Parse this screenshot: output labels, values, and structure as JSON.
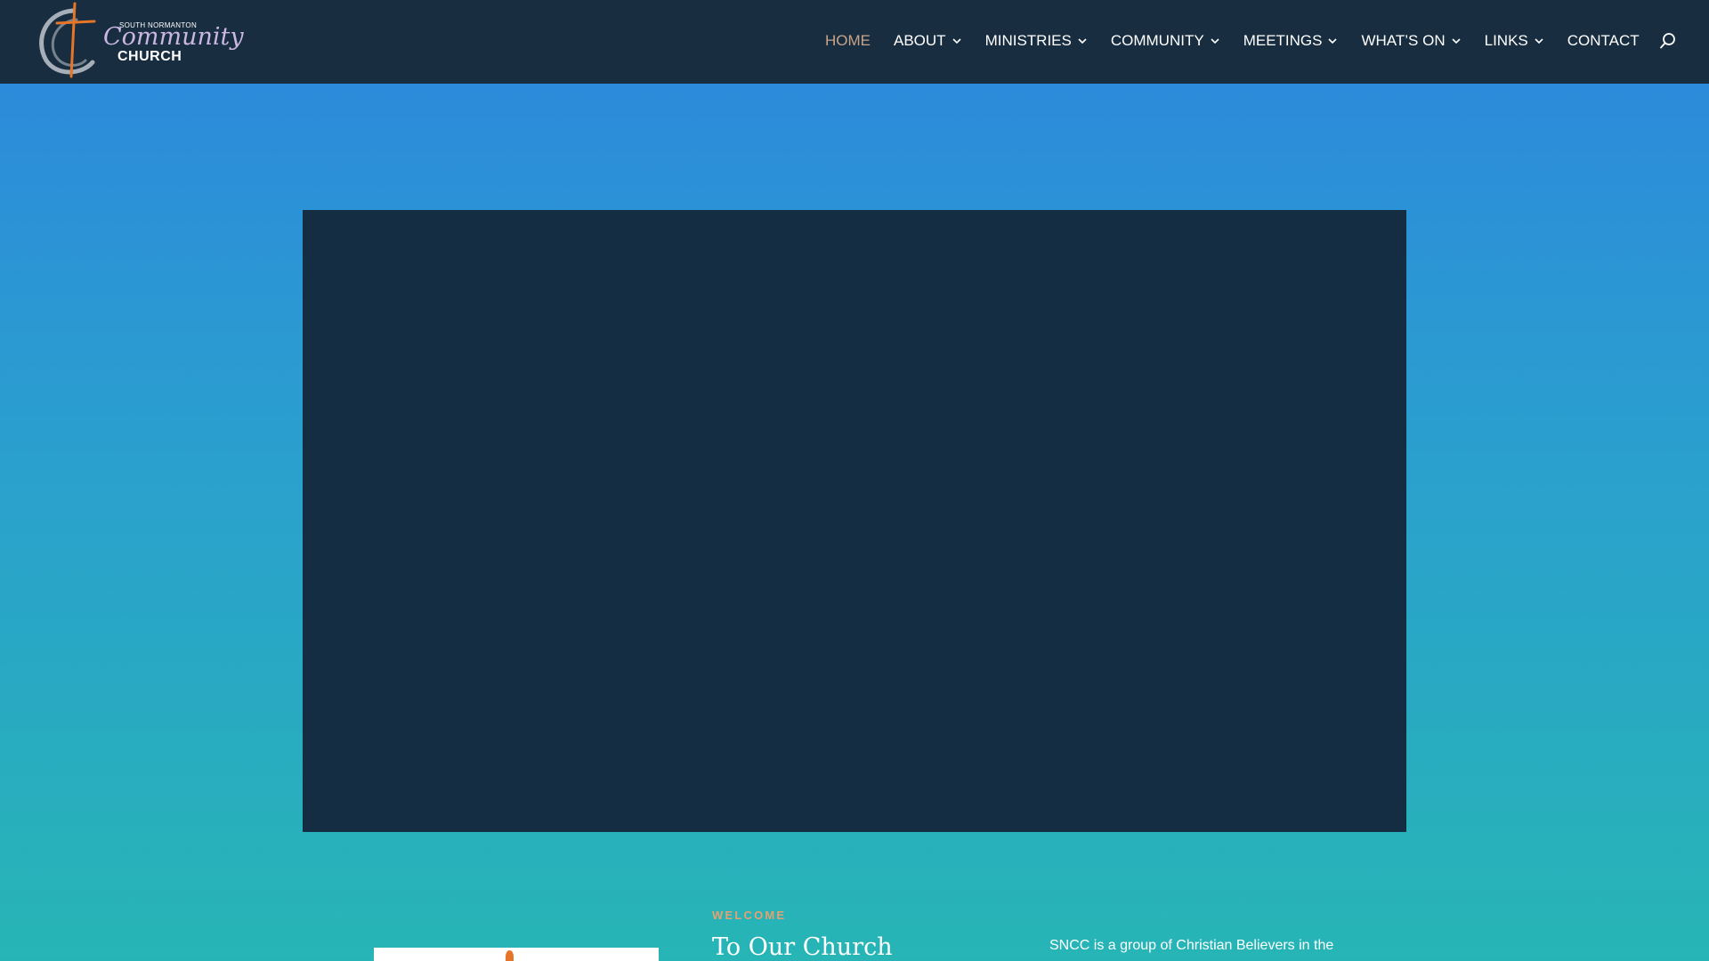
{
  "header": {
    "logo": {
      "line_small": "SOUTH NORMANTON",
      "line_script": "Community",
      "line_main": "CHURCH"
    },
    "nav": [
      {
        "label": "HOME",
        "active": true,
        "has_dropdown": false
      },
      {
        "label": "ABOUT",
        "active": false,
        "has_dropdown": true
      },
      {
        "label": "MINISTRIES",
        "active": false,
        "has_dropdown": true
      },
      {
        "label": "COMMUNITY",
        "active": false,
        "has_dropdown": true
      },
      {
        "label": "MEETINGS",
        "active": false,
        "has_dropdown": true
      },
      {
        "label": "WHAT’S ON",
        "active": false,
        "has_dropdown": true
      },
      {
        "label": "LINKS",
        "active": false,
        "has_dropdown": true
      },
      {
        "label": "CONTACT",
        "active": false,
        "has_dropdown": false
      }
    ],
    "search_icon": "search-icon"
  },
  "welcome": {
    "eyebrow": "WELCOME",
    "title": "To Our Church",
    "body": "SNCC is a group of Christian Believers in the"
  },
  "colors": {
    "header_bg": "#182d3f",
    "nav_active": "#c8a48b",
    "video_panel": "#152d42",
    "accent": "#e5a271",
    "gradient_top": "#2d86de",
    "gradient_bottom": "#27b5b5"
  }
}
